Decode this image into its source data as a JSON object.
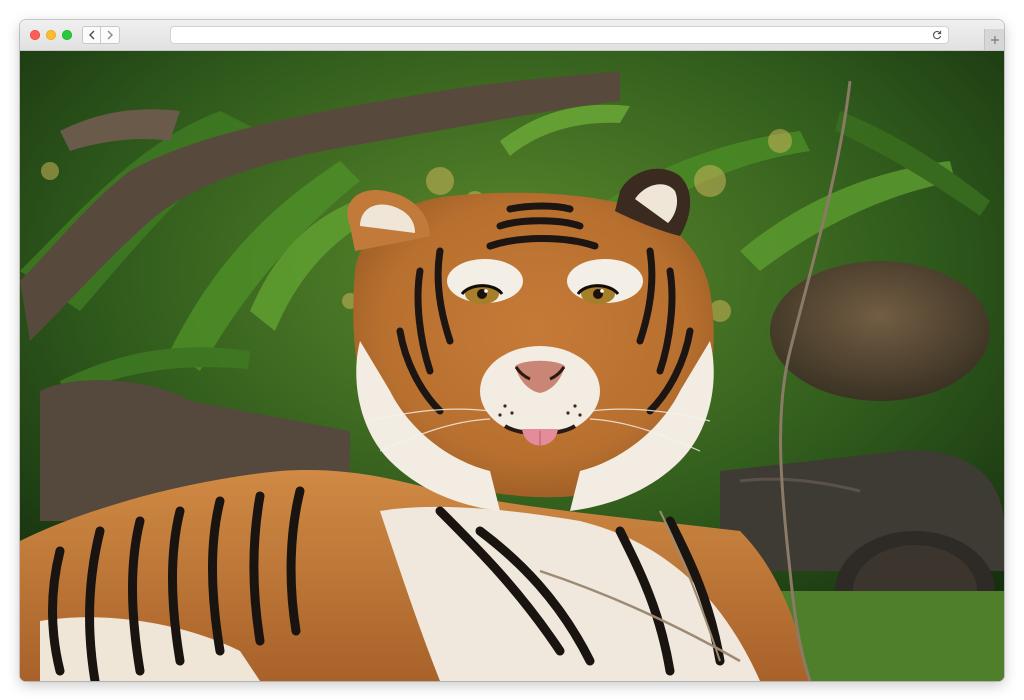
{
  "browser": {
    "address_url": "",
    "icons": {
      "back": "chevron-left-icon",
      "forward": "chevron-right-icon",
      "reload": "reload-icon",
      "new_tab": "plus-icon"
    },
    "traffic_lights": {
      "close": "#fd5f57",
      "minimize": "#fdbc2e",
      "maximize": "#29c840"
    }
  },
  "content": {
    "image_subject": "tiger-photo",
    "colors": {
      "foliage": "#2f6b1f",
      "fur_orange": "#c47a3a",
      "fur_white": "#f2ece2",
      "stripe": "#1c1512",
      "log": "#4a4038",
      "grass": "#4f7f2a"
    }
  }
}
